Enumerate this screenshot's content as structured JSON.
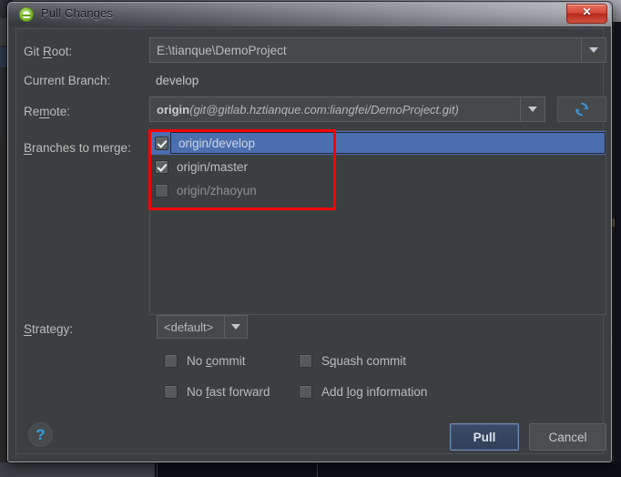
{
  "window": {
    "title": "Pull Changes",
    "app_icon": "android-studio-icon",
    "close_label": "✕"
  },
  "form": {
    "git_root": {
      "label_pre": "Git ",
      "label_mnemonic": "R",
      "label_post": "oot:",
      "value": "E:\\tianque\\DemoProject",
      "icon": "chevron-down-icon"
    },
    "current_branch": {
      "label": "Current Branch:",
      "value": "develop"
    },
    "remote": {
      "label_pre": "Re",
      "label_mnemonic": "m",
      "label_post": "ote:",
      "value_bold": "origin",
      "value_italic": "(git@gitlab.hztianque.com:liangfei/DemoProject.git)",
      "icon": "chevron-down-icon",
      "refresh_icon": "refresh-icon"
    },
    "branches": {
      "label_pre": "",
      "label_mnemonic": "B",
      "label_post": "ranches to merge:",
      "items": [
        {
          "name": "origin/develop",
          "checked": true,
          "selected": true,
          "enabled": true
        },
        {
          "name": "origin/master",
          "checked": true,
          "selected": false,
          "enabled": true
        },
        {
          "name": "origin/zhaoyun",
          "checked": false,
          "selected": false,
          "enabled": false
        }
      ]
    },
    "strategy": {
      "label_pre": "",
      "label_mnemonic": "S",
      "label_post": "trategy:",
      "value": "<default>",
      "icon": "chevron-down-icon"
    },
    "options": [
      {
        "pre": "No ",
        "mnemonic": "c",
        "post": "ommit",
        "checked": false
      },
      {
        "pre": "S",
        "mnemonic": "q",
        "post": "uash commit",
        "checked": false
      },
      {
        "pre": "No ",
        "mnemonic": "f",
        "post": "ast forward",
        "checked": false
      },
      {
        "pre": "Add ",
        "mnemonic": "l",
        "post": "og information",
        "checked": false
      }
    ]
  },
  "footer": {
    "help_label": "?",
    "pull_label": "Pull",
    "cancel_label": "Cancel"
  },
  "annotation": {
    "color": "#fe0000",
    "target": "branches-to-merge-list"
  }
}
